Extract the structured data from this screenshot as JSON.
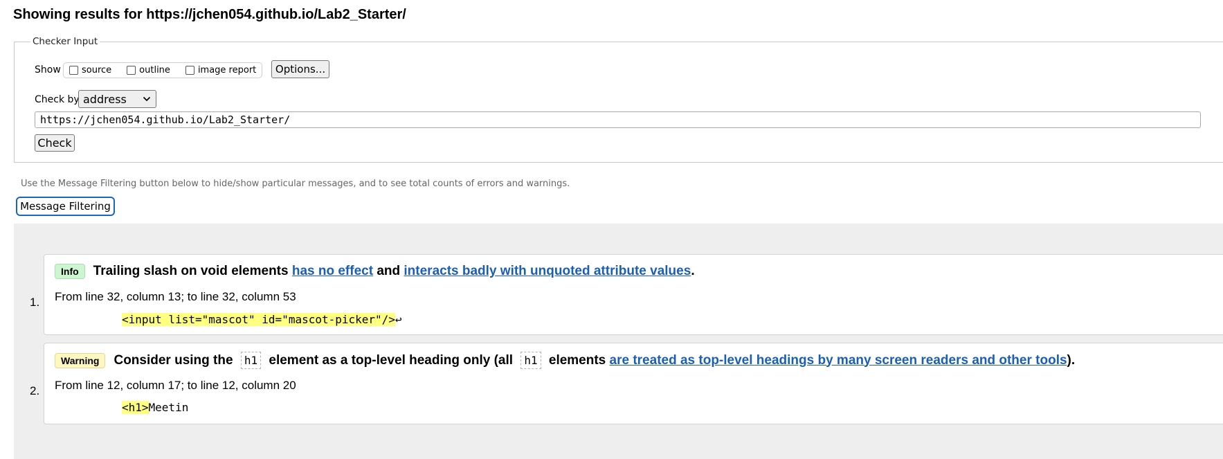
{
  "page": {
    "results_heading": "Showing results for https://jchen054.github.io/Lab2_Starter/"
  },
  "checker_input": {
    "legend": "Checker Input",
    "show_label": "Show",
    "show_options": [
      {
        "label": "source",
        "checked": false
      },
      {
        "label": "outline",
        "checked": false
      },
      {
        "label": "image report",
        "checked": false
      }
    ],
    "options_button": "Options...",
    "check_by_label": "Check by",
    "check_by_value": "address",
    "url_value": "https://jchen054.github.io/Lab2_Starter/",
    "check_button": "Check"
  },
  "filtering": {
    "hint": "Use the Message Filtering button below to hide/show particular messages, and to see total counts of errors and warnings.",
    "button_label": "Message Filtering"
  },
  "messages": [
    {
      "number": "1.",
      "type": "Info",
      "text_parts": [
        "Trailing slash on void elements ",
        "has no effect",
        " and ",
        "interacts badly with unquoted attribute values",
        "."
      ],
      "location": "From line 32, column 13; to line 32, column 53",
      "extract_highlight": "<input list=\"mascot\" id=\"mascot-picker\"/>",
      "extract_rest": "↩"
    },
    {
      "number": "2.",
      "type": "Warning",
      "text_parts": [
        "Consider using the ",
        "h1",
        " element as a top-level heading only (all ",
        "h1",
        " elements ",
        "are treated as top-level headings by many screen readers and other tools",
        ")."
      ],
      "location": "From line 12, column 17; to line 12, column 20",
      "extract_highlight": "<h1>",
      "extract_rest": "Meetin"
    }
  ],
  "colors": {
    "info_badge": "#cdf5d0",
    "warning_badge": "#fff7c2",
    "highlight": "#ffff80",
    "link": "#1a5fb4",
    "panel_bg": "#eeeeee"
  }
}
